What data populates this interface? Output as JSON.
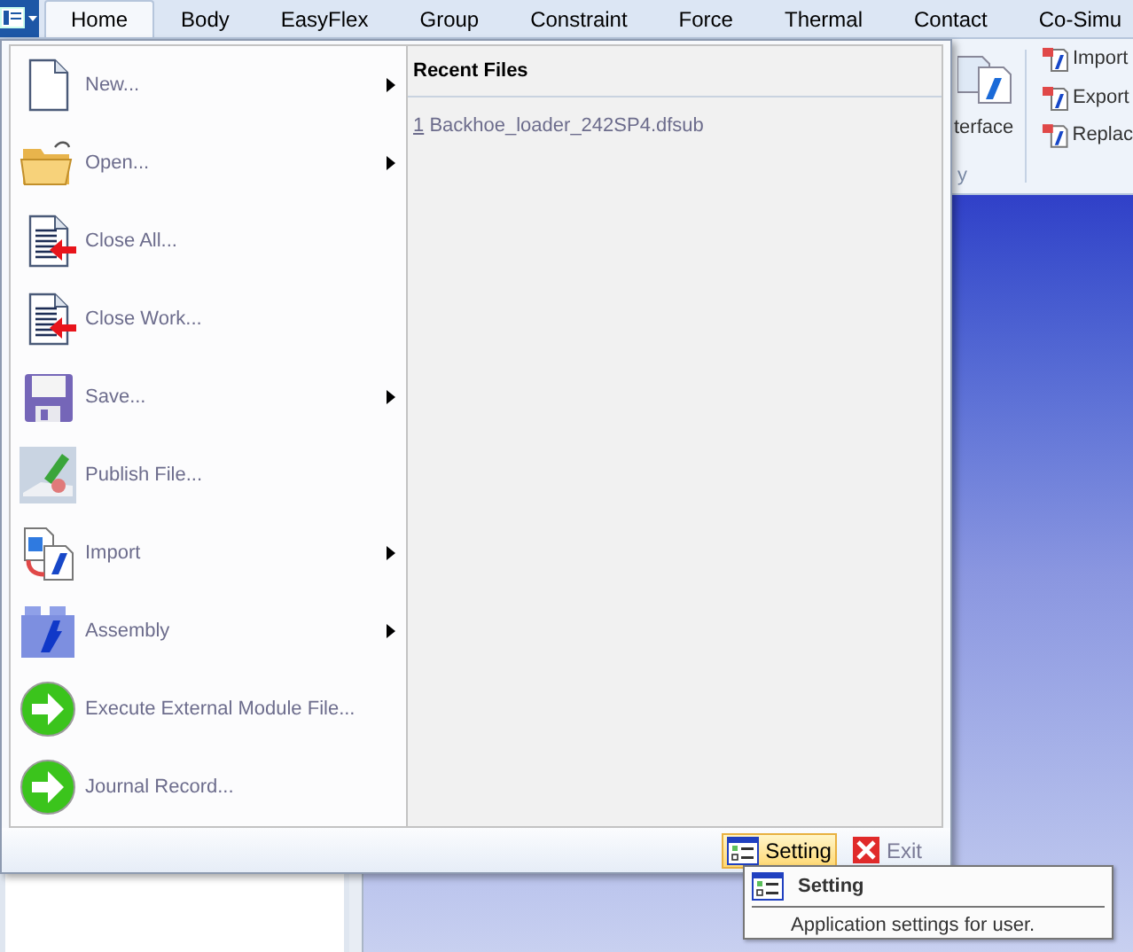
{
  "tabs": [
    {
      "label": "Home",
      "selected": true
    },
    {
      "label": "Body",
      "selected": false
    },
    {
      "label": "EasyFlex",
      "selected": false
    },
    {
      "label": "Group",
      "selected": false
    },
    {
      "label": "Constraint",
      "selected": false
    },
    {
      "label": "Force",
      "selected": false
    },
    {
      "label": "Thermal",
      "selected": false
    },
    {
      "label": "Contact",
      "selected": false
    },
    {
      "label": "Co-Simu",
      "selected": false
    }
  ],
  "ribbon": {
    "interface_label": "terface",
    "group_label": "y",
    "items": [
      "Import",
      "Export",
      "Replac"
    ]
  },
  "menu": {
    "items": [
      {
        "label": "New...",
        "submenu": true
      },
      {
        "label": "Open...",
        "submenu": true
      },
      {
        "label": "Close All...",
        "submenu": false
      },
      {
        "label": "Close Work...",
        "submenu": false
      },
      {
        "label": "Save...",
        "submenu": true
      },
      {
        "label": "Publish File...",
        "submenu": false
      },
      {
        "label": "Import",
        "submenu": true
      },
      {
        "label": "Assembly",
        "submenu": true
      },
      {
        "label": "Execute External Module File...",
        "submenu": false
      },
      {
        "label": "Journal Record...",
        "submenu": false
      }
    ],
    "recent_title": "Recent Files",
    "recent_files": [
      {
        "number": "1",
        "name": "Backhoe_loader_242SP4.dfsub"
      }
    ],
    "footer_buttons": [
      {
        "kind": "setting",
        "label": "Setting",
        "selected": true
      },
      {
        "kind": "exit",
        "label": "Exit",
        "selected": false
      }
    ]
  },
  "tooltip": {
    "title": "Setting",
    "description": "Application settings for user."
  }
}
